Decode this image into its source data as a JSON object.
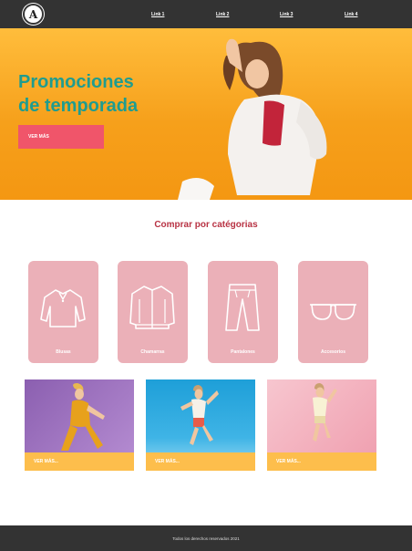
{
  "nav": {
    "logo_letter": "A",
    "links": [
      "Link 1",
      "Link 2",
      "Link 3",
      "Link 4"
    ]
  },
  "hero": {
    "title_line1": "Promociones",
    "title_line2": "de temporada",
    "button_label": "VER MÁS"
  },
  "categories": {
    "title": "Comprar por catégorias",
    "items": [
      {
        "label": "Blusas",
        "icon": "blouse-icon"
      },
      {
        "label": "Chamarras",
        "icon": "jacket-icon"
      },
      {
        "label": "Pantalones",
        "icon": "pants-icon"
      },
      {
        "label": "Accesorios",
        "icon": "sunglasses-icon"
      }
    ]
  },
  "promos": [
    {
      "label": "VER MÁS..."
    },
    {
      "label": "VER MÁS..."
    },
    {
      "label": "VER MÁS..."
    }
  ],
  "footer": {
    "text": "Todos los derechos reservados 2021"
  },
  "colors": {
    "nav_bg": "#333333",
    "hero_orange": "#f6a01b",
    "title_teal": "#1f9c8f",
    "button_pink": "#f0556a",
    "section_red": "#b83344",
    "card_pink": "#ebb0b8",
    "promo_yellow": "#fdbe4c"
  }
}
